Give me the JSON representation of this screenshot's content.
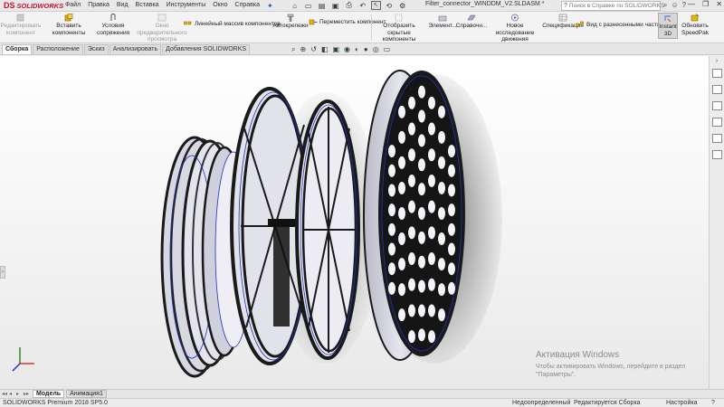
{
  "app": {
    "brand_prefix": "DS",
    "brand_name": "SOLIDWORKS"
  },
  "menu": [
    "Файл",
    "Правка",
    "Вид",
    "Вставка",
    "Инструменты",
    "Окно",
    "Справка"
  ],
  "document_title": "Filter_connector_WINDDM_V2.SLDASM *",
  "search": {
    "placeholder": "Поиск в Справке по SOLIDWORKS"
  },
  "ribbon": {
    "edit_component": "Редактировать\nкомпонент",
    "insert_components": "Вставить компоненты",
    "mates": "Условия\nсопряжения",
    "preview_window": "Окно предварительного\nпросмотра компонента",
    "linear_pattern": "Линейный массив компонентов",
    "smart_fasteners": "Автокрепежи",
    "move_component": "Переместить компонент",
    "show_hidden": "Отобразить скрытые\nкомпоненты",
    "assembly_features": "Элемент...",
    "reference_geometry": "Справочн...",
    "new_motion_study": "Новое исследование\nдвижения",
    "bom": "Спецификация",
    "exploded_view": "Вид с разнесенными частями",
    "instant3d": "Instant\n3D",
    "update_speedpak": "Обновить\nSpeedPak"
  },
  "tabs": [
    "Сборка",
    "Расположение",
    "Эскиз",
    "Анализировать",
    "Добавления SOLIDWORKS"
  ],
  "watermark": {
    "title": "Активация Windows",
    "text": "Чтобы активировать Windows, перейдите в раздел \"Параметры\"."
  },
  "bottom_tabs": [
    "Модель",
    "Анимация1"
  ],
  "status": {
    "version": "SOLIDWORKS Premium 2018 SP5.0",
    "definition": "Недоопределенный",
    "mode": "Редактируется Сборка",
    "custom": "Настройка"
  },
  "colors": {
    "brand": "#c8102e",
    "part_edge": "#1a1a1a",
    "sketch": "#2233bb",
    "face": "#d4d4e0"
  }
}
